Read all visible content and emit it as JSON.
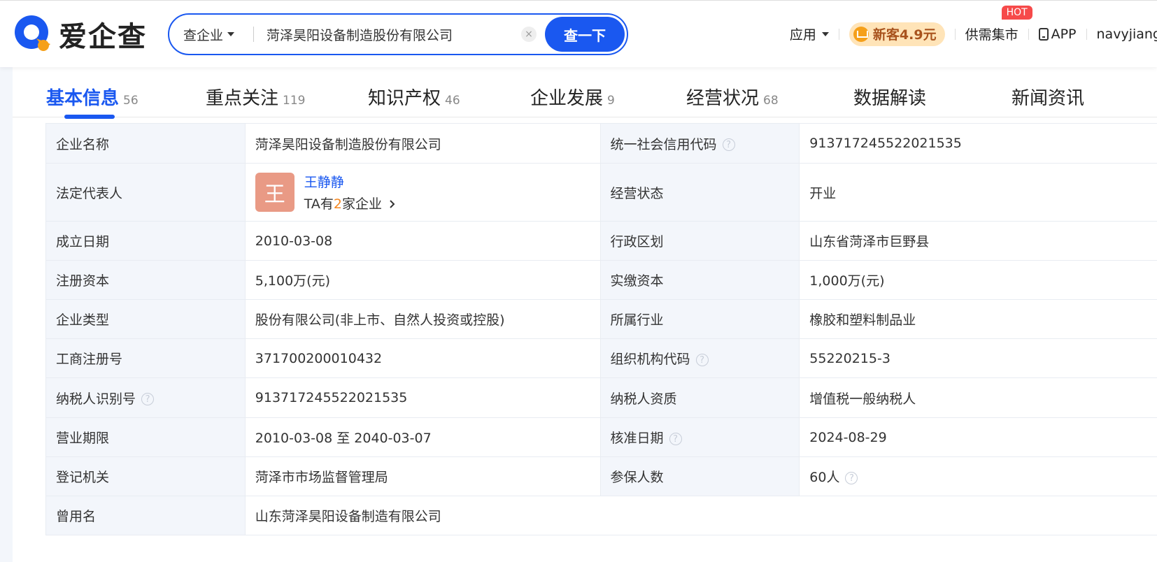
{
  "header": {
    "brand": "爱企查",
    "search": {
      "category": "查企业",
      "query": "菏泽昊阳设备制造股份有限公司",
      "clear_glyph": "×",
      "button": "查一下"
    },
    "nav": {
      "apps": "应用",
      "promo": "新客4.9元",
      "supply": "供需集市",
      "hot_badge": "HOT",
      "app": "APP",
      "user": "navyjiang"
    }
  },
  "tabs": [
    {
      "label": "基本信息",
      "count": "56"
    },
    {
      "label": "重点关注",
      "count": "119"
    },
    {
      "label": "知识产权",
      "count": "46"
    },
    {
      "label": "企业发展",
      "count": "9"
    },
    {
      "label": "经营状况",
      "count": "68"
    },
    {
      "label": "数据解读",
      "count": ""
    },
    {
      "label": "新闻资讯",
      "count": ""
    }
  ],
  "info": {
    "company_name_label": "企业名称",
    "company_name": "菏泽昊阳设备制造股份有限公司",
    "credit_code_label": "统一社会信用代码",
    "credit_code": "913717245522021535",
    "legal_rep_label": "法定代表人",
    "legal_rep_avatar": "王",
    "legal_rep_name": "王静静",
    "legal_rep_more_prefix": "TA有",
    "legal_rep_more_count": "2",
    "legal_rep_more_suffix": "家企业",
    "status_label": "经营状态",
    "status": "开业",
    "founded_label": "成立日期",
    "founded": "2010-03-08",
    "region_label": "行政区划",
    "region": "山东省菏泽市巨野县",
    "reg_capital_label": "注册资本",
    "reg_capital": "5,100万(元)",
    "paid_capital_label": "实缴资本",
    "paid_capital": "1,000万(元)",
    "type_label": "企业类型",
    "type": "股份有限公司(非上市、自然人投资或控股)",
    "industry_label": "所属行业",
    "industry": "橡胶和塑料制品业",
    "reg_no_label": "工商注册号",
    "reg_no": "371700200010432",
    "org_code_label": "组织机构代码",
    "org_code": "55220215-3",
    "taxpayer_id_label": "纳税人识别号",
    "taxpayer_id": "913717245522021535",
    "taxpayer_qual_label": "纳税人资质",
    "taxpayer_qual": "增值税一般纳税人",
    "term_label": "营业期限",
    "term": "2010-03-08 至 2040-03-07",
    "approved_label": "核准日期",
    "approved": "2024-08-29",
    "authority_label": "登记机关",
    "authority": "菏泽市市场监督管理局",
    "insured_label": "参保人数",
    "insured": "60人",
    "former_name_label": "曾用名",
    "former_name": "山东菏泽昊阳设备制造有限公司"
  },
  "icons": {
    "help": "?"
  },
  "colors": {
    "accent": "#1a58f0",
    "key_bg": "#f3f6fb",
    "hot": "#f64a4a",
    "promo_bg": "#ffe4b8",
    "avatar_bg": "#e99a85"
  }
}
